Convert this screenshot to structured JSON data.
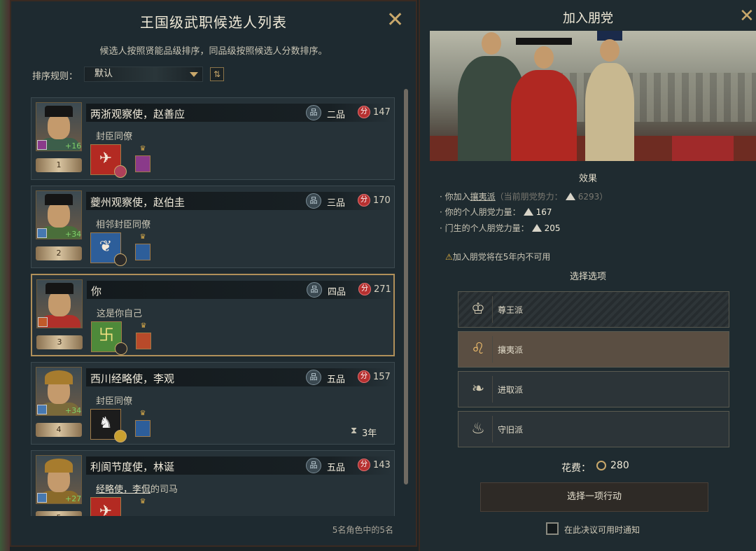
{
  "left_panel": {
    "title": "王国级武职候选人列表",
    "subtitle": "候选人按照贤能品级排序，同品级按照候选人分数排序。",
    "sort_label": "排序规则：",
    "sort_value": "默认",
    "footer": "5名角色中的5名",
    "close_icon": "close-icon"
  },
  "candidates": [
    {
      "name": "两浙观察使，赵善应",
      "grade": "二品",
      "score": "147",
      "relation": "封臣同僚",
      "rank": "1",
      "bonus": "+16",
      "timer": ""
    },
    {
      "name": "夔州观察使，赵伯圭",
      "grade": "三品",
      "score": "170",
      "relation": "相邻封臣同僚",
      "rank": "2",
      "bonus": "+34",
      "timer": ""
    },
    {
      "name": "你",
      "grade": "四品",
      "score": "271",
      "relation": "这是你自己",
      "rank": "3",
      "bonus": "",
      "timer": ""
    },
    {
      "name": "西川经略使，李观",
      "grade": "五品",
      "score": "157",
      "relation": "封臣同僚",
      "rank": "4",
      "bonus": "+34",
      "timer": "3年"
    },
    {
      "name": "利阆节度使，林诞",
      "grade": "五品",
      "score": "143",
      "relation_link": "经略使，李侃",
      "relation_rest": "的司马",
      "rank": "5",
      "bonus": "+27",
      "timer": ""
    }
  ],
  "right_panel": {
    "title": "加入朋党",
    "effects_header": "效果",
    "effect1_prefix": "你加入",
    "effect1_faction": "攘夷派",
    "effect1_note": "（当前朋党势力：",
    "effect1_power": "6293",
    "effect1_close": "）",
    "effect2_label": "你的个人朋党力量：",
    "effect2_value": "167",
    "effect3_label": "门生的个人朋党力量：",
    "effect3_value": "205",
    "warning": "加入朋党将在5年内不可用",
    "options_header": "选择选项",
    "options": [
      {
        "label": "尊王派",
        "icon": "emperor-icon"
      },
      {
        "label": "攘夷派",
        "icon": "lion-icon"
      },
      {
        "label": "进取派",
        "icon": "crane-icon"
      },
      {
        "label": "守旧派",
        "icon": "cauldron-icon"
      }
    ],
    "cost_label": "花费：",
    "cost_value": "280",
    "action_button": "选择一项行动",
    "notify_label": "在此决议可用时通知"
  },
  "colors": {
    "accent": "#c9a86b",
    "score_red": "#b63030",
    "bonus_green": "#7fd06a"
  }
}
